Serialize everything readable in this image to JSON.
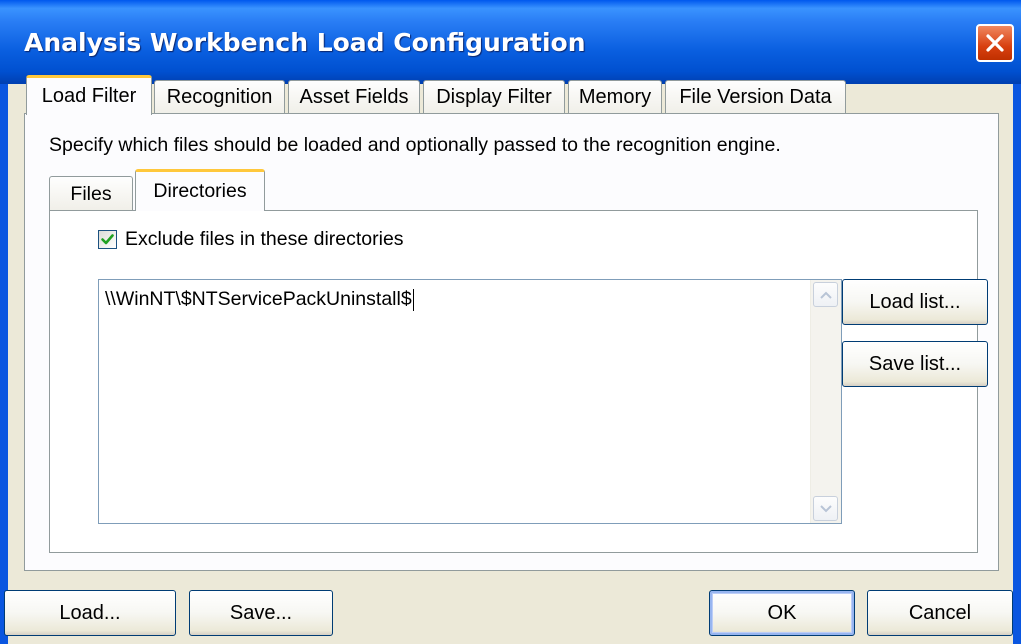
{
  "window": {
    "title": "Analysis Workbench Load Configuration",
    "close_icon": "close-icon"
  },
  "tabs": [
    {
      "label": "Load Filter",
      "active": true
    },
    {
      "label": "Recognition",
      "active": false
    },
    {
      "label": "Asset Fields",
      "active": false
    },
    {
      "label": "Display Filter",
      "active": false
    },
    {
      "label": "Memory",
      "active": false
    },
    {
      "label": "File Version Data",
      "active": false
    }
  ],
  "load_filter": {
    "instruction": "Specify which files should be loaded and optionally passed to the recognition engine.",
    "subtabs": [
      {
        "label": "Files",
        "active": false
      },
      {
        "label": "Directories",
        "active": true
      }
    ],
    "directories": {
      "exclude_checkbox": {
        "label": "Exclude files in these directories",
        "checked": true
      },
      "list_text": "\\\\WinNT\\$NTServicePackUninstall$",
      "load_list_label": "Load list...",
      "save_list_label": "Save list..."
    }
  },
  "footer": {
    "load_label": "Load...",
    "save_label": "Save...",
    "ok_label": "OK",
    "cancel_label": "Cancel"
  },
  "colors": {
    "titlebar": "#0a5fe0",
    "dialog_bg": "#ece9d8",
    "active_tab_accent": "#ffc83c",
    "close_button": "#d84010",
    "checkmark": "#21a121"
  }
}
